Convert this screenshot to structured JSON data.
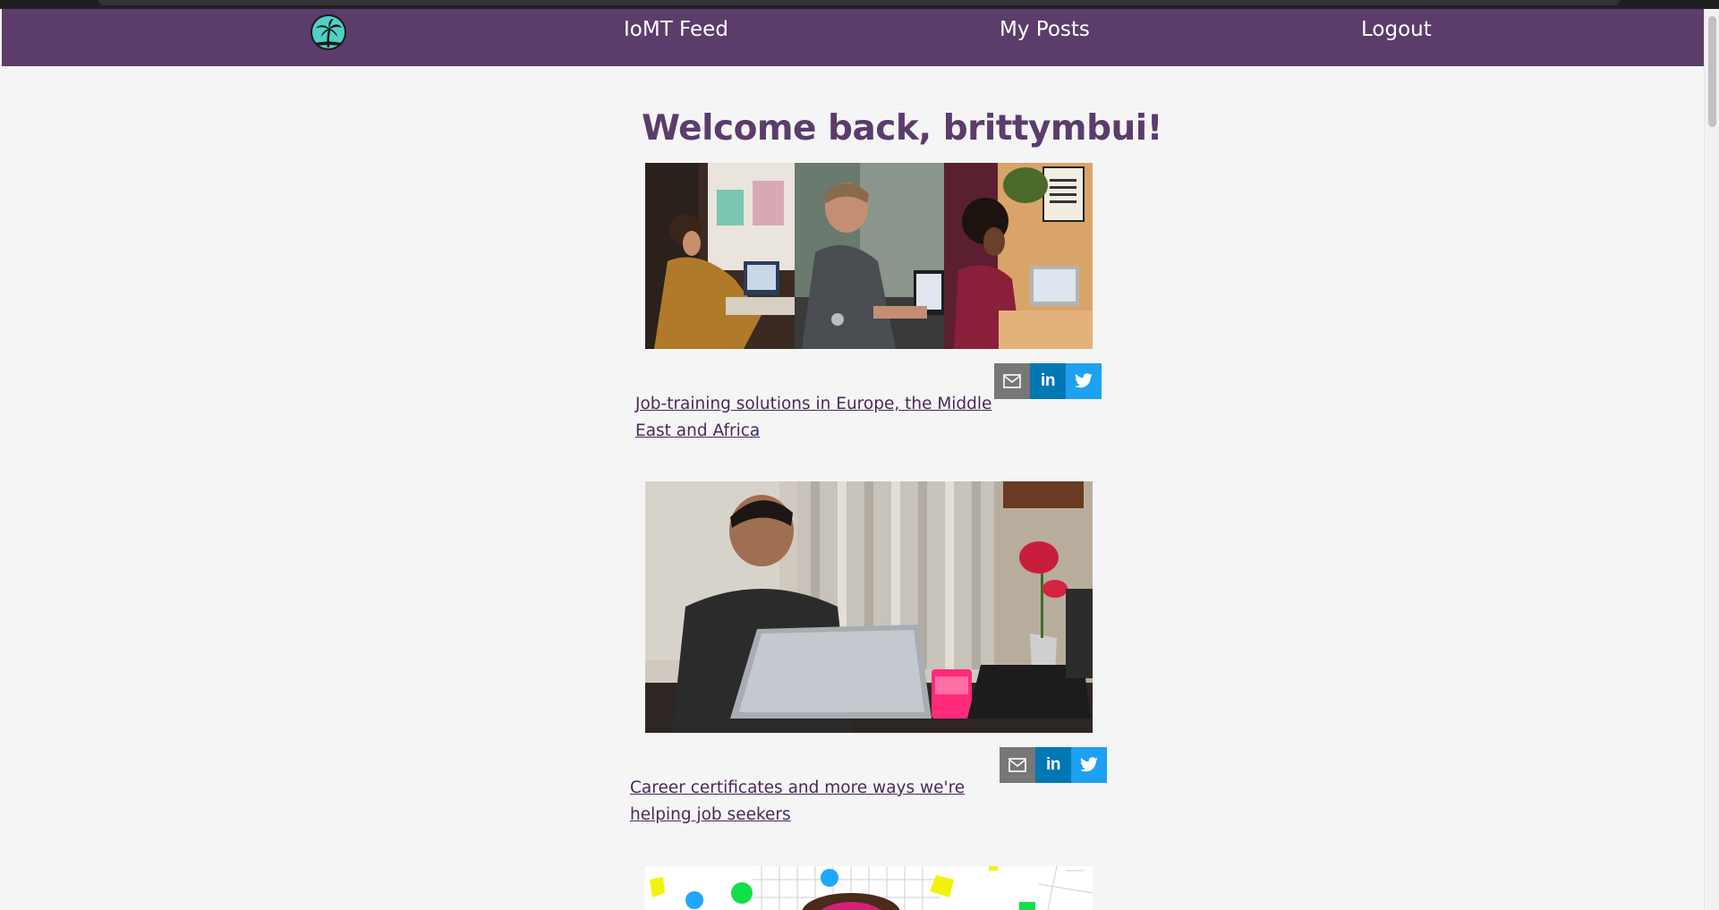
{
  "app": {
    "logo_icon": "palm-tree-icon",
    "brand_color": "#5b3c6b",
    "background_color": "#f5f5f5"
  },
  "navbar": {
    "feed_label": "IoMT Feed",
    "posts_label": "My Posts",
    "logout_label": "Logout"
  },
  "main": {
    "welcome": "Welcome back, brittymbui!"
  },
  "posts": [
    {
      "image_alt": "three people working on laptops at home",
      "title": "Job-training solutions in Europe, the Middle East and Africa",
      "share": {
        "email_icon": "mail-icon",
        "linkedin_label": "in",
        "twitter_icon": "twitter-bird-icon"
      }
    },
    {
      "image_alt": "man working on a laptop at a table",
      "title": "Career certificates and more ways we're helping job seekers",
      "share": {
        "email_icon": "mail-icon",
        "linkedin_label": "in",
        "twitter_icon": "twitter-bird-icon"
      }
    },
    {
      "image_alt": "colorful illustration with geometric shapes"
    }
  ]
}
